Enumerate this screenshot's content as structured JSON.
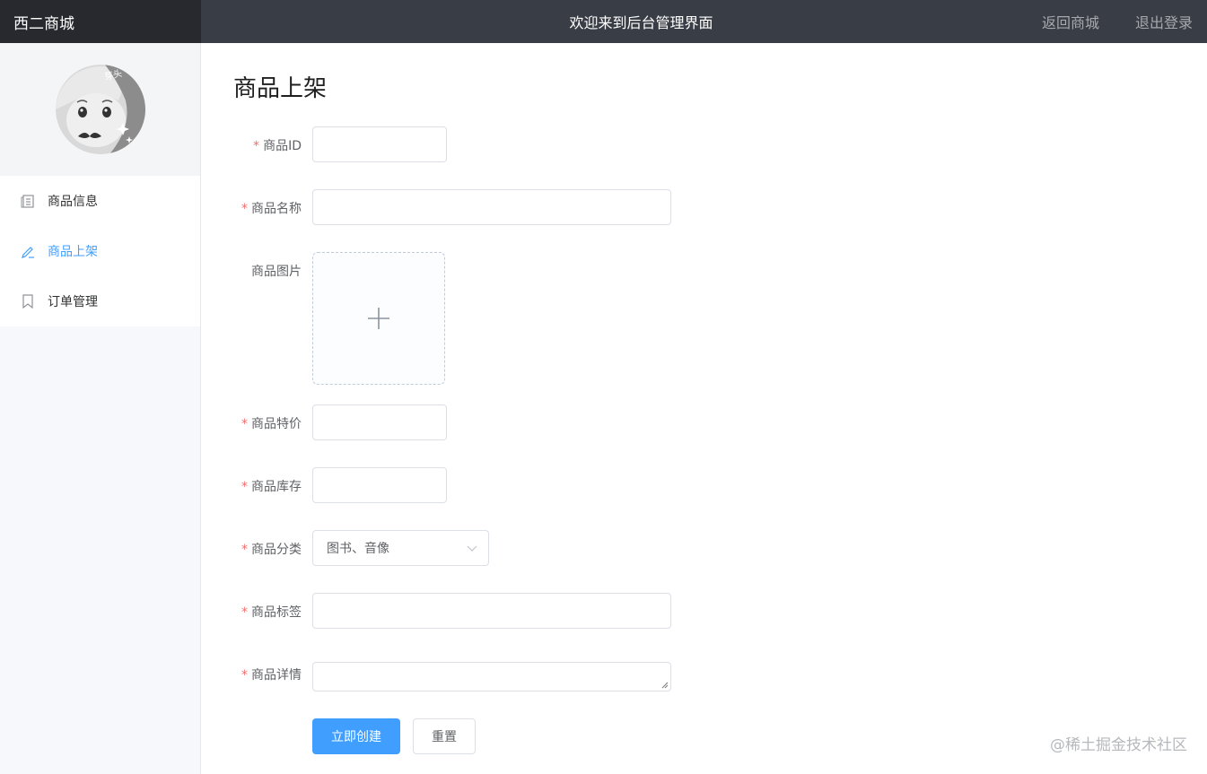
{
  "header": {
    "brand": "西二商城",
    "welcome": "欢迎来到后台管理界面",
    "links": [
      "返回商城",
      "退出登录"
    ]
  },
  "sidebar": {
    "menu": [
      {
        "label": "商品信息",
        "icon": "document-icon",
        "active": false
      },
      {
        "label": "商品上架",
        "icon": "edit-pen-icon",
        "active": true
      },
      {
        "label": "订单管理",
        "icon": "bookmark-icon",
        "active": false
      }
    ]
  },
  "main": {
    "title": "商品上架",
    "fields": {
      "id": {
        "label": "商品ID",
        "required": true,
        "value": ""
      },
      "name": {
        "label": "商品名称",
        "required": true,
        "value": ""
      },
      "image": {
        "label": "商品图片",
        "required": false
      },
      "price": {
        "label": "商品特价",
        "required": true,
        "value": ""
      },
      "stock": {
        "label": "商品库存",
        "required": true,
        "value": ""
      },
      "category": {
        "label": "商品分类",
        "required": true,
        "value": "图书、音像"
      },
      "tags": {
        "label": "商品标签",
        "required": true,
        "value": ""
      },
      "detail": {
        "label": "商品详情",
        "required": true,
        "value": ""
      }
    },
    "buttons": {
      "create": "立即创建",
      "reset": "重置"
    }
  },
  "watermark": "@稀土掘金技术社区",
  "colors": {
    "primary": "#409eff",
    "topbar": "#393d45",
    "brand_bg": "#27292e",
    "required": "#f56c6c"
  }
}
